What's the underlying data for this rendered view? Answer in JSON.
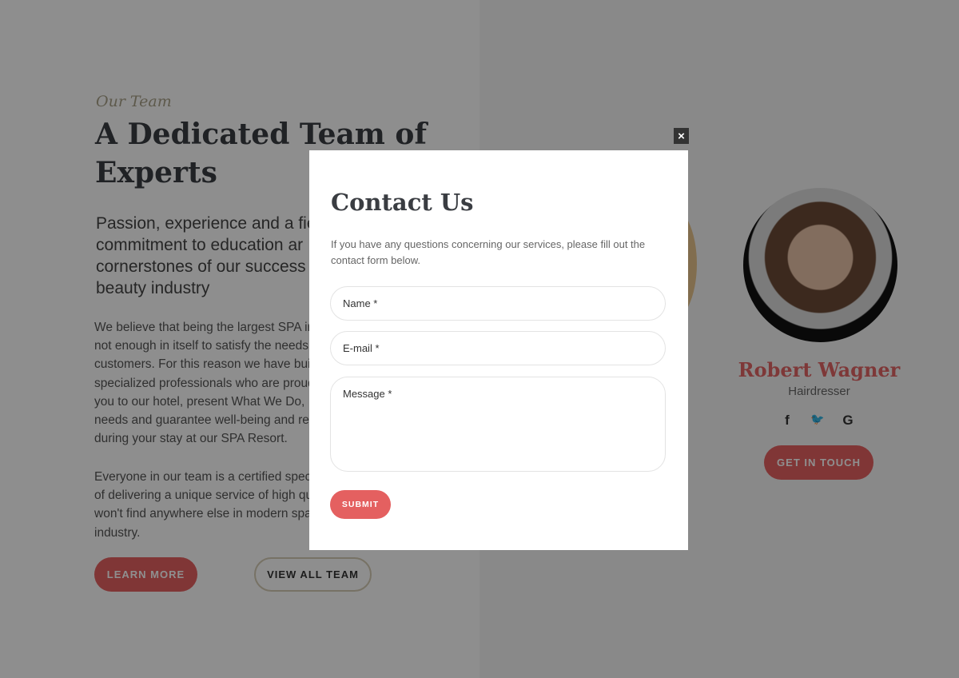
{
  "team_section": {
    "kicker": "Our Team",
    "title": "A Dedicated Team of Experts",
    "lead": "Passion, experience and a fie\ncommitment to education ar\ncornerstones of our success\nbeauty industry",
    "paragraph1": "We believe that being the largest SPA ir\nnot enough in itself to satisfy the needs\ncustomers. For this reason we have buil\nspecialized professionals who are proud\nyou to our hotel, present What We Do,\nneeds and guarantee well-being and rel\nduring your stay at our SPA Resort.",
    "paragraph2": "Everyone in our team is a certified speci\nof delivering a unique service of high qu\nwon't find anywhere else in modern spa\nindustry.",
    "learn_more": "LEARN MORE",
    "view_all": "VIEW ALL TEAM"
  },
  "member": {
    "name": "Robert Wagner",
    "role": "Hairdresser",
    "socials": [
      {
        "icon": "facebook-icon",
        "glyph": "f"
      },
      {
        "icon": "twitter-icon",
        "glyph": "🐦"
      },
      {
        "icon": "google-icon",
        "glyph": "G"
      }
    ],
    "cta": "GET IN TOUCH"
  },
  "modal": {
    "close": "×",
    "title": "Contact Us",
    "description": "If you have any questions concerning our services, please fill out the contact form below.",
    "name_placeholder": "Name *",
    "email_placeholder": "E-mail *",
    "message_placeholder": "Message *",
    "submit": "SUBMIT"
  },
  "colors": {
    "accent": "#e46060",
    "heading": "#3a3d42"
  }
}
